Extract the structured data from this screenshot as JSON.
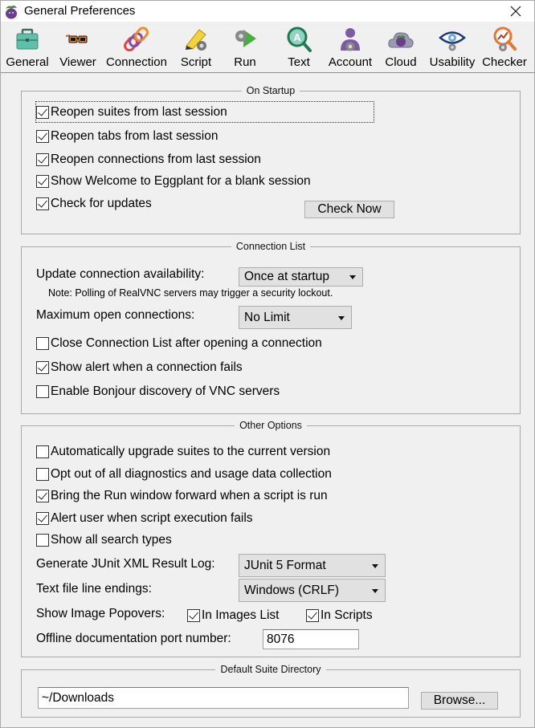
{
  "window": {
    "title": "General Preferences",
    "close_icon": "close-icon"
  },
  "toolbar": {
    "items": [
      {
        "label": "General",
        "icon": "toolbox-icon"
      },
      {
        "label": "Viewer",
        "icon": "glasses-icon"
      },
      {
        "label": "Connection",
        "icon": "chain-link-icon"
      },
      {
        "label": "Script",
        "icon": "pencil-gear-icon"
      },
      {
        "label": "Run",
        "icon": "run-arrow-gear-icon"
      },
      {
        "label": "Text",
        "icon": "text-magnifier-icon"
      },
      {
        "label": "Account",
        "icon": "user-gear-icon"
      },
      {
        "label": "Cloud",
        "icon": "cloud-icon"
      },
      {
        "label": "Usability",
        "icon": "eye-gear-icon"
      },
      {
        "label": "Checker",
        "icon": "checker-magnifier-icon"
      }
    ]
  },
  "on_startup": {
    "title": "On Startup",
    "options": [
      {
        "label": "Reopen suites from last session",
        "checked": true
      },
      {
        "label": "Reopen tabs from last session",
        "checked": true
      },
      {
        "label": "Reopen connections from last session",
        "checked": true
      },
      {
        "label": "Show Welcome to Eggplant for a blank session",
        "checked": true
      },
      {
        "label": "Check for updates",
        "checked": true
      }
    ],
    "check_now_label": "Check Now"
  },
  "connection_list": {
    "title": "Connection List",
    "update_label": "Update connection availability:",
    "update_value": "Once at startup",
    "note": "Note: Polling of RealVNC servers may trigger a security lockout.",
    "max_label": "Maximum open connections:",
    "max_value": "No Limit",
    "options": [
      {
        "label": "Close Connection List after opening a connection",
        "checked": false
      },
      {
        "label": "Show alert when a connection fails",
        "checked": true
      },
      {
        "label": "Enable Bonjour discovery of VNC servers",
        "checked": false
      }
    ]
  },
  "other_options": {
    "title": "Other Options",
    "options": [
      {
        "label": "Automatically upgrade suites to the current version",
        "checked": false
      },
      {
        "label": "Opt out of all diagnostics and usage data collection",
        "checked": false
      },
      {
        "label": "Bring the Run window forward when a script is run",
        "checked": true
      },
      {
        "label": "Alert user when script execution fails",
        "checked": true
      },
      {
        "label": "Show all search types",
        "checked": false
      }
    ],
    "junit_label": "Generate JUnit XML Result Log:",
    "junit_value": "JUnit 5 Format",
    "line_endings_label": "Text file line endings:",
    "line_endings_value": "Windows (CRLF)",
    "popovers_label": "Show Image Popovers:",
    "popovers_images_list": {
      "label": "In Images List",
      "checked": true
    },
    "popovers_scripts": {
      "label": "In Scripts",
      "checked": true
    },
    "port_label": "Offline documentation port number:",
    "port_value": "8076"
  },
  "default_suite_directory": {
    "title": "Default Suite Directory",
    "path_value": "~/Downloads",
    "browse_label": "Browse..."
  }
}
